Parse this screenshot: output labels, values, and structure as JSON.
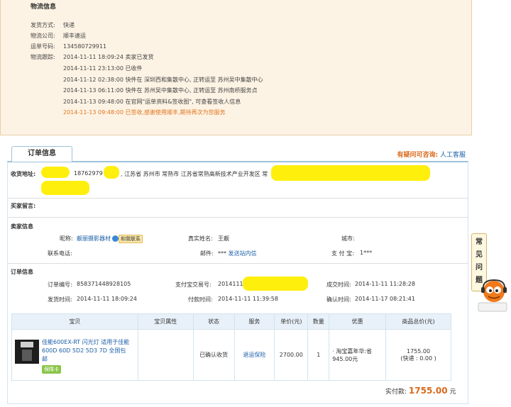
{
  "logistics": {
    "title": "物流信息",
    "rows": [
      {
        "label": "发货方式:",
        "value": "快递"
      },
      {
        "label": "物流公司:",
        "value": "顺丰速运"
      },
      {
        "label": "运单号码:",
        "value": "134580729911"
      },
      {
        "label": "物流跟踪:",
        "value": "2014-11-11 18:09:24 卖家已发货"
      }
    ],
    "tracking": [
      "2014-11-11 23:13:00 已收件",
      "2014-11-12 02:38:00 快件在 深圳西和集散中心, 正转运至 苏州吴中集散中心",
      "2014-11-13 06:11:00 快件在 苏州吴中集散中心, 正转运至 苏州南桥服务点",
      "2014-11-13 09:48:00 在官网\"运单资料&签收图\", 可查看签收人信息",
      "2014-11-13 09:48:00 已签收,感谢使用顺丰,期待再次为您服务"
    ]
  },
  "order": {
    "tab_label": "订单信息",
    "help_question": "有疑问可咨询:",
    "help_service": "人工客服",
    "address_label": "收货地址:",
    "address_phone": "18762979",
    "address_text": ", 江苏省 苏州市 常熟市 江苏省常熟高新技术产业开发区 常",
    "buyer_note_label": "买家留言:",
    "seller_section": "卖家信息",
    "nickname_label": "昵称:",
    "nickname_value": "靓丽摄影器材",
    "contact_button": "和我联系",
    "realname_label": "真实姓名:",
    "realname_value": "王靓",
    "city_label": "城市:",
    "phone_label": "联系电话:",
    "email_label": "邮件:",
    "email_value": "***",
    "email_link": "发送站内信",
    "alipay_label": "支 付 宝:",
    "alipay_value": "1***",
    "order_section": "订单信息",
    "order_no_label": "订单编号:",
    "order_no": "858371448928105",
    "alipay_no_label": "支付宝交易号:",
    "alipay_no": "2014111",
    "deal_time_label": "成交时间:",
    "deal_time": "2014-11-11 11:28:28",
    "ship_time_label": "发货时间:",
    "ship_time": "2014-11-11 18:09:24",
    "pay_time_label": "付款时间:",
    "pay_time": "2014-11-11 11:39:58",
    "confirm_time_label": "确认时间:",
    "confirm_time": "2014-11-17 08:21:41"
  },
  "items_table": {
    "headers": [
      "宝贝",
      "宝贝属性",
      "状态",
      "服务",
      "单价(元)",
      "数量",
      "优惠",
      "商品总价(元)"
    ],
    "rows": [
      {
        "title": "佳能600EX-RT 闪光灯 适用于佳能600D 60D 5D2 5D3 7D 全国包邮",
        "badge": "保障卡",
        "status": "已确认收货",
        "service": "退运保险",
        "price": "2700.00",
        "qty": "1",
        "discount": "淘宝嘉年华:省945.00元",
        "total": "1755.00",
        "shipping": "(快递 : 0.00 )"
      }
    ]
  },
  "paid": {
    "label": "实付款:",
    "amount": "1755.00",
    "unit": "元"
  },
  "side": {
    "faq": [
      "常",
      "见",
      "问",
      "题"
    ]
  }
}
